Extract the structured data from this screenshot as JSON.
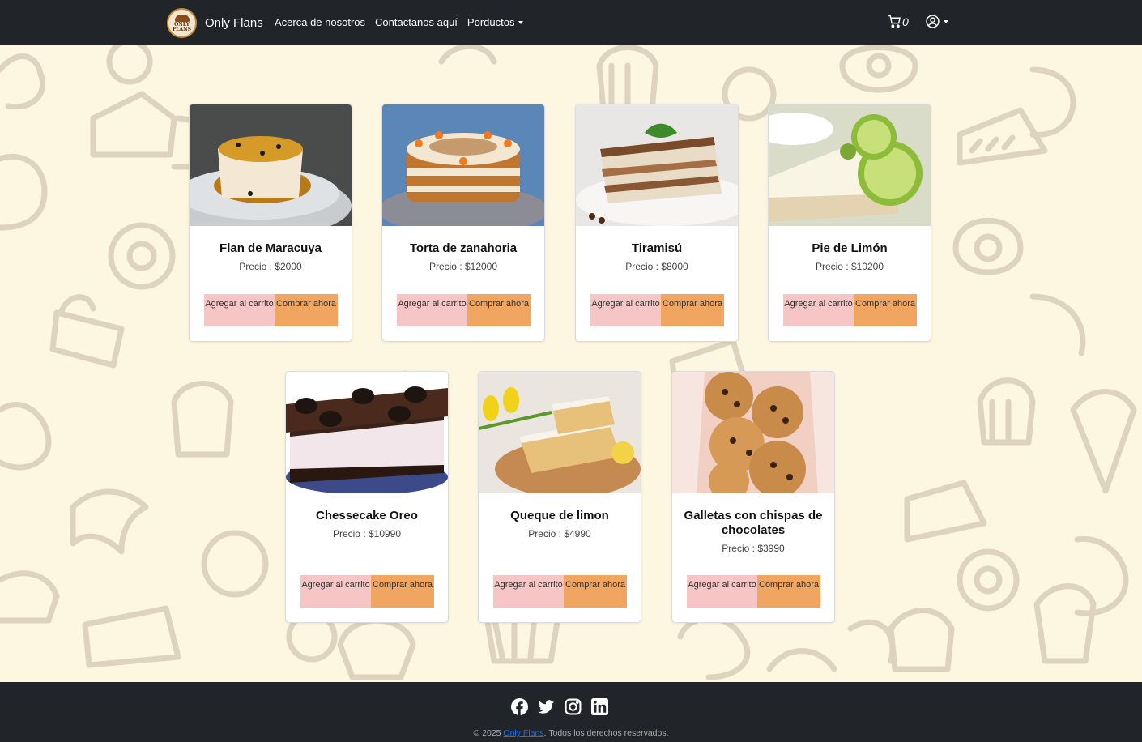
{
  "navbar": {
    "brand_logo_text": "ONLY FLANS",
    "brand_name": "Only Flans",
    "links": [
      "Acerca de nosotros",
      "Contactanos aquí",
      "Porductos"
    ],
    "cart_count": "0"
  },
  "products": [
    {
      "name": "Flan de Maracuya",
      "price": "Precio : $2000",
      "image": "flan"
    },
    {
      "name": "Torta de zanahoria",
      "price": "Precio : $12000",
      "image": "carrot-cake"
    },
    {
      "name": "Tiramisú",
      "price": "Precio : $8000",
      "image": "tiramisu"
    },
    {
      "name": "Pie de Limón",
      "price": "Precio : $10200",
      "image": "lemon-pie"
    },
    {
      "name": "Chessecake Oreo",
      "price": "Precio : $10990",
      "image": "oreo-cheesecake"
    },
    {
      "name": "Queque de limon",
      "price": "Precio : $4990",
      "image": "lemon-loaf"
    },
    {
      "name": "Galletas con chispas de chocolates",
      "price": "Precio : $3990",
      "image": "cookies"
    }
  ],
  "buttons": {
    "add_to_cart": "Agregar al carrito",
    "buy_now": "Comprar ahora"
  },
  "footer": {
    "copy_prefix": "© 2025 ",
    "copy_link": "Only Flans",
    "copy_suffix": ". Todos los derechos reservados.",
    "socials": [
      "facebook-icon",
      "twitter-icon",
      "instagram-icon",
      "linkedin-icon"
    ]
  },
  "colors": {
    "navbar_bg": "#212529",
    "page_bg": "#fdf6e1",
    "btn_cart": "#f6c6c6",
    "btn_buy": "#f0a560"
  }
}
